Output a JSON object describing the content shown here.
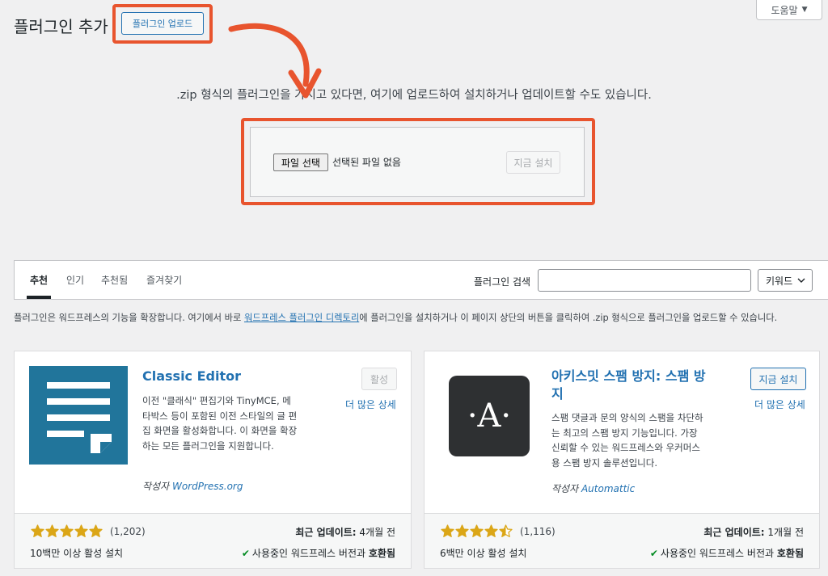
{
  "header": {
    "help_label": "도움말",
    "title": "플러그인 추가",
    "upload_button": "플러그인 업로드"
  },
  "upload": {
    "description": ".zip 형식의 플러그인을 가지고 있다면, 여기에 업로드하여 설치하거나 업데이트할 수도 있습니다.",
    "file_button": "파일 선택",
    "no_file": "선택된 파일 없음",
    "install_button": "지금 설치"
  },
  "filter": {
    "tabs": [
      {
        "label": "추천",
        "active": true
      },
      {
        "label": "인기",
        "active": false
      },
      {
        "label": "추천됨",
        "active": false
      },
      {
        "label": "즐겨찾기",
        "active": false
      }
    ],
    "search_label": "플러그인 검색",
    "search_value": "",
    "search_type": "키워드"
  },
  "intro": {
    "before": "플러그인은 워드프레스의 기능을 확장합니다. 여기에서 바로 ",
    "link": "워드프레스 플러그인 디렉토리",
    "after": "에 플러그인을 설치하거나 이 페이지 상단의 버튼을 클릭하여 .zip 형식으로 플러그인을 업로드할 수 있습니다."
  },
  "plugins": [
    {
      "name": "Classic Editor",
      "action": "활성",
      "action_enabled": false,
      "more": "더 많은 상세",
      "description": "이전 \"클래식\" 편집기와 TinyMCE, 메타박스 등이 포함된 이전 스타일의 글 편집 화면을 활성화합니다. 이 화면을 확장하는 모든 플러그인을 지원합니다.",
      "author_prefix": "작성자",
      "author": "WordPress.org",
      "rating": 5,
      "rating_count": "(1,202)",
      "installs": "10백만 이상 활성 설치",
      "updated_label": "최근 업데이트:",
      "updated_value": "4개월 전",
      "compat_prefix": "사용중인 워드프레스 버전과",
      "compat_bold": "호환됨",
      "icon_color": "#21759b"
    },
    {
      "name": "아키스밋 스팸 방지: 스팸 방지",
      "action": "지금 설치",
      "action_enabled": true,
      "more": "더 많은 상세",
      "description": "스팸 댓글과 문의 양식의 스팸을 차단하는 최고의 스팸 방지 기능입니다. 가장 신뢰할 수 있는 워드프레스와 우커머스용 스팸 방지 솔루션입니다.",
      "author_prefix": "작성자",
      "author": "Automattic",
      "rating": 4.5,
      "rating_count": "(1,116)",
      "installs": "6백만 이상 활성 설치",
      "updated_label": "최근 업데이트:",
      "updated_value": "1개월 전",
      "compat_prefix": "사용중인 워드프레스 버전과",
      "compat_bold": "호환됨",
      "icon_letter": "·A·",
      "icon_color": "#2e3032"
    }
  ],
  "colors": {
    "annotation": "#e8542e",
    "link": "#2271b1",
    "star": "#dba617"
  }
}
